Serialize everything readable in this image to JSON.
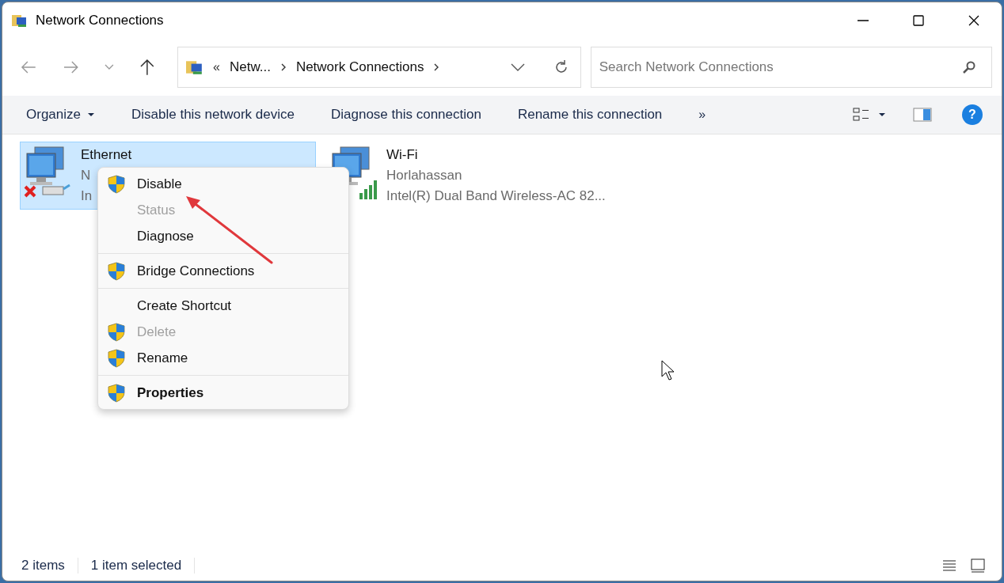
{
  "window": {
    "title": "Network Connections"
  },
  "address": {
    "overflow": "«",
    "crumbs": [
      "Netw...",
      "Network Connections"
    ]
  },
  "search": {
    "placeholder": "Search Network Connections"
  },
  "toolbar": {
    "organize": "Organize",
    "commands": [
      "Disable this network device",
      "Diagnose this connection",
      "Rename this connection"
    ],
    "more": "»",
    "help": "?"
  },
  "connections": [
    {
      "name": "Ethernet",
      "lines": [
        "N",
        "In"
      ],
      "selected": true,
      "kind": "wired"
    },
    {
      "name": "Wi-Fi",
      "lines": [
        "Horlahassan",
        "Intel(R) Dual Band Wireless-AC 82..."
      ],
      "selected": false,
      "kind": "wireless"
    }
  ],
  "context_menu": {
    "groups": [
      [
        {
          "label": "Disable",
          "shield": true,
          "disabled": false,
          "bold": false
        },
        {
          "label": "Status",
          "shield": false,
          "disabled": true,
          "bold": false
        },
        {
          "label": "Diagnose",
          "shield": false,
          "disabled": false,
          "bold": false
        }
      ],
      [
        {
          "label": "Bridge Connections",
          "shield": true,
          "disabled": false,
          "bold": false
        }
      ],
      [
        {
          "label": "Create Shortcut",
          "shield": false,
          "disabled": false,
          "bold": false
        },
        {
          "label": "Delete",
          "shield": true,
          "disabled": true,
          "bold": false
        },
        {
          "label": "Rename",
          "shield": true,
          "disabled": false,
          "bold": false
        }
      ],
      [
        {
          "label": "Properties",
          "shield": true,
          "disabled": false,
          "bold": true
        }
      ]
    ]
  },
  "status_bar": {
    "count": "2 items",
    "selection": "1 item selected"
  }
}
